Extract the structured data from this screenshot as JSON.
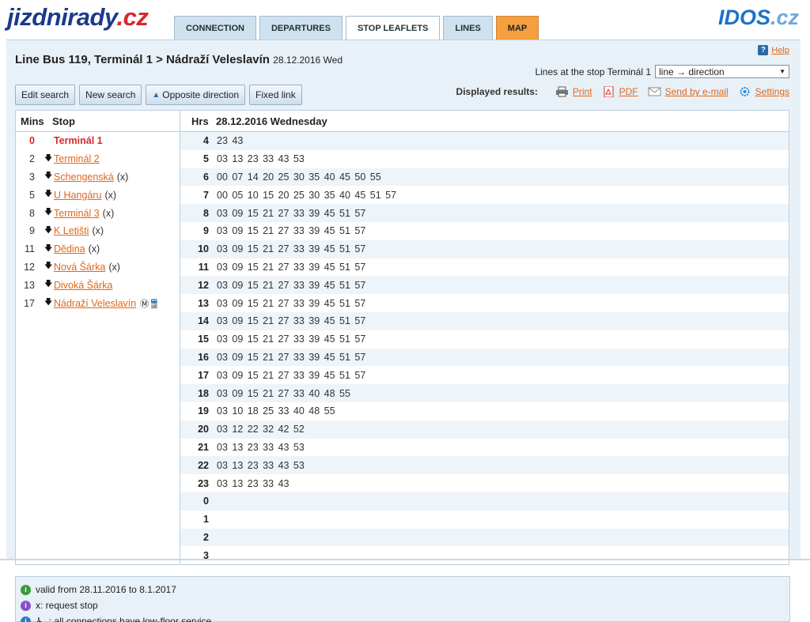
{
  "header": {
    "logo_main": "jizdnirady",
    "logo_suffix": ".cz",
    "brand_main": "IDOS",
    "brand_suffix": ".cz"
  },
  "tabs": [
    {
      "label": "CONNECTION"
    },
    {
      "label": "DEPARTURES"
    },
    {
      "label": "STOP LEAFLETS"
    },
    {
      "label": "LINES"
    },
    {
      "label": "MAP"
    }
  ],
  "title": {
    "text": "Line Bus 119, Terminál 1 > Nádraží Veleslavín",
    "date": "28.12.2016 Wed"
  },
  "help": {
    "label": "Help"
  },
  "lines_at_stop": {
    "label": "Lines at the stop Terminál 1",
    "selected": "line → direction"
  },
  "buttons": {
    "edit_search": "Edit search",
    "new_search": "New search",
    "opposite_direction": "Opposite direction",
    "fixed_link": "Fixed link"
  },
  "results": {
    "label": "Displayed results:",
    "print": "Print",
    "pdf": "PDF",
    "email": "Send by e-mail",
    "settings": "Settings"
  },
  "table": {
    "stops_header_mins": "Mins",
    "stops_header_stop": "Stop",
    "times_header_hrs": "Hrs",
    "times_header_date": "28.12.2016 Wednesday",
    "stops": [
      {
        "mins": "0",
        "name": "Terminál 1",
        "note": ""
      },
      {
        "mins": "2",
        "name": "Terminál 2",
        "note": ""
      },
      {
        "mins": "3",
        "name": "Schengenská",
        "note": "(x)"
      },
      {
        "mins": "5",
        "name": "U Hangáru",
        "note": "(x)"
      },
      {
        "mins": "8",
        "name": "Terminál 3",
        "note": "(x)"
      },
      {
        "mins": "9",
        "name": "K Letišti",
        "note": "(x)"
      },
      {
        "mins": "11",
        "name": "Dědina",
        "note": "(x)"
      },
      {
        "mins": "12",
        "name": "Nová Šárka",
        "note": "(x)"
      },
      {
        "mins": "13",
        "name": "Divoká Šárka",
        "note": ""
      },
      {
        "mins": "17",
        "name": "Nádraží Veleslavín",
        "note": ""
      }
    ],
    "times": [
      {
        "hr": "4",
        "mins": "23 43"
      },
      {
        "hr": "5",
        "mins": "03 13 23 33 43 53"
      },
      {
        "hr": "6",
        "mins": "00 07 14 20 25 30 35 40 45 50 55"
      },
      {
        "hr": "7",
        "mins": "00 05 10 15 20 25 30 35 40 45 51 57"
      },
      {
        "hr": "8",
        "mins": "03 09 15 21 27 33 39 45 51 57"
      },
      {
        "hr": "9",
        "mins": "03 09 15 21 27 33 39 45 51 57"
      },
      {
        "hr": "10",
        "mins": "03 09 15 21 27 33 39 45 51 57"
      },
      {
        "hr": "11",
        "mins": "03 09 15 21 27 33 39 45 51 57"
      },
      {
        "hr": "12",
        "mins": "03 09 15 21 27 33 39 45 51 57"
      },
      {
        "hr": "13",
        "mins": "03 09 15 21 27 33 39 45 51 57"
      },
      {
        "hr": "14",
        "mins": "03 09 15 21 27 33 39 45 51 57"
      },
      {
        "hr": "15",
        "mins": "03 09 15 21 27 33 39 45 51 57"
      },
      {
        "hr": "16",
        "mins": "03 09 15 21 27 33 39 45 51 57"
      },
      {
        "hr": "17",
        "mins": "03 09 15 21 27 33 39 45 51 57"
      },
      {
        "hr": "18",
        "mins": "03 09 15 21 27 33 40 48 55"
      },
      {
        "hr": "19",
        "mins": "03 10 18 25 33 40 48 55"
      },
      {
        "hr": "20",
        "mins": "03 12 22 32 42 52"
      },
      {
        "hr": "21",
        "mins": "03 13 23 33 43 53"
      },
      {
        "hr": "22",
        "mins": "03 13 23 33 43 53"
      },
      {
        "hr": "23",
        "mins": "03 13 23 33 43"
      },
      {
        "hr": "0",
        "mins": ""
      },
      {
        "hr": "1",
        "mins": ""
      },
      {
        "hr": "2",
        "mins": ""
      },
      {
        "hr": "3",
        "mins": ""
      }
    ]
  },
  "legend": {
    "valid": "valid from 28.11.2016 to 8.1.2017",
    "request": "x: request stop",
    "lowfloor": ": all connections have low-floor service"
  },
  "colors": {
    "accent_orange": "#e0671c",
    "logo_blue": "#1b3a8c",
    "red": "#d6282e",
    "idos_blue": "#1d72c8"
  }
}
